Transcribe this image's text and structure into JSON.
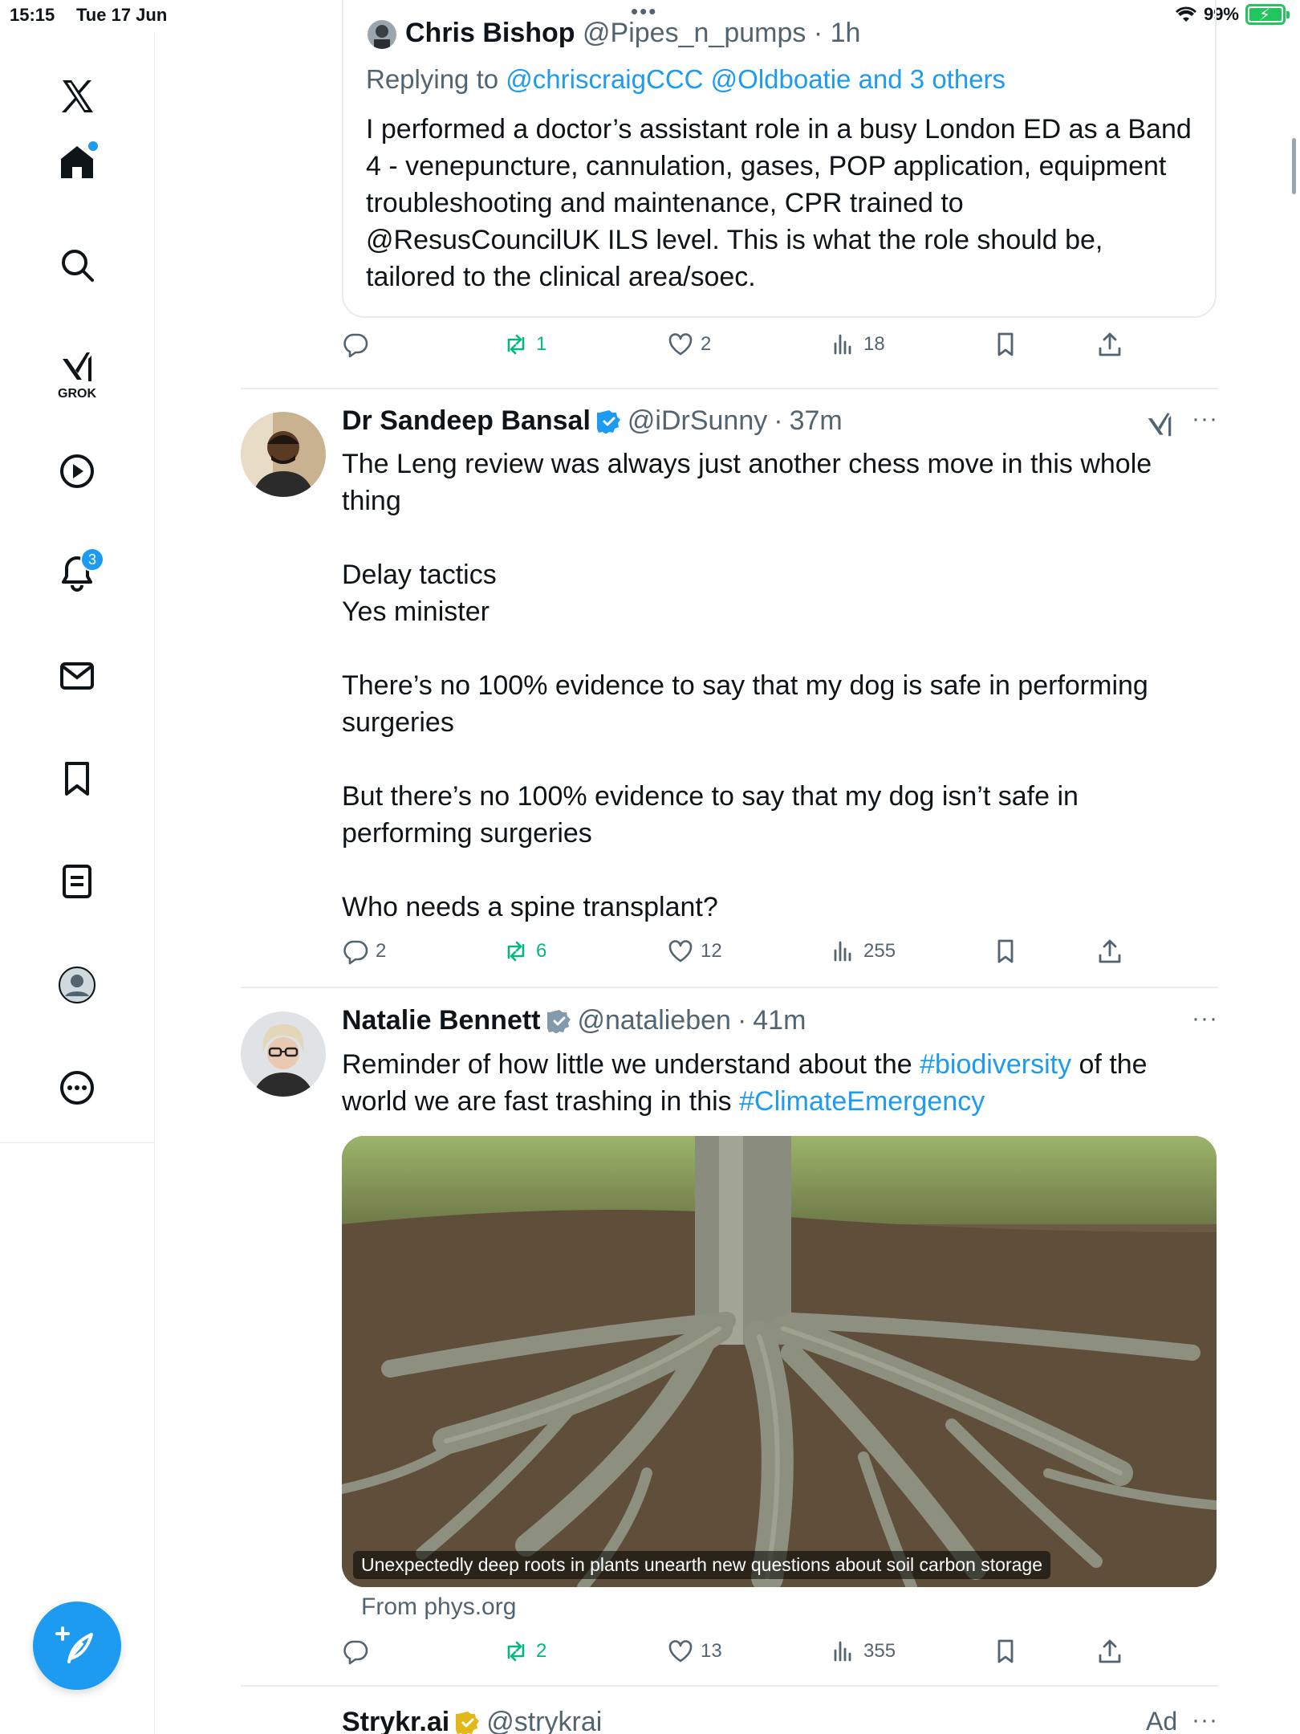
{
  "status_bar": {
    "time": "15:15",
    "date": "Tue 17 Jun",
    "battery": "99%"
  },
  "sidebar": {
    "grok_label": "GROK",
    "notifications_count": "3"
  },
  "quote_post": {
    "author": "Chris Bishop",
    "handle": "@Pipes_n_pumps",
    "time": "1h",
    "replying_prefix": "Replying to",
    "replying_to": "@chriscraigCCC @Oldboatie and 3 others",
    "lines": [
      "I performed a doctor’s assistant role in a busy London ED as a Band",
      "4 - venepuncture, cannulation, gases, POP application, equipment",
      "troubleshooting and maintenance, CPR trained to",
      "@ResusCouncilUK ILS level. This is what the role should be,",
      "tailored to the clinical area/soec."
    ],
    "stats": {
      "replies": "",
      "reposts": "1",
      "likes": "2",
      "views": "18"
    }
  },
  "post1": {
    "author": "Dr Sandeep Bansal",
    "handle": "@iDrSunny",
    "time": "37m",
    "lines": [
      "The Leng review was always just another chess move in this whole",
      "thing",
      "",
      "Delay tactics",
      "Yes minister",
      "",
      "There’s no 100% evidence to say that my dog is safe in performing",
      "surgeries",
      "",
      "But there’s no 100% evidence to say that my dog isn’t safe in",
      "performing surgeries",
      "",
      "Who needs a spine transplant?"
    ],
    "stats": {
      "replies": "2",
      "reposts": "6",
      "likes": "12",
      "views": "255"
    }
  },
  "post2": {
    "author": "Natalie Bennett",
    "handle": "@natalieben",
    "time": "41m",
    "line1_a": "Reminder of how little we understand about the ",
    "hashtag1": "#biodiversity",
    "line1_b": " of the",
    "line2_a": "world we are fast trashing in this ",
    "hashtag2": "#ClimateEmergency",
    "media_caption": "Unexpectedly deep roots in plants unearth new questions about soil carbon storage",
    "from": "From phys.org",
    "stats": {
      "replies": "",
      "reposts": "2",
      "likes": "13",
      "views": "355"
    }
  },
  "post3": {
    "author": "Strykr.ai",
    "handle": "@strykrai",
    "ad_label": "Ad"
  },
  "colors": {
    "accent": "#1d9bf0",
    "repost": "#00ba7c",
    "muted": "#536471",
    "divider": "#e6ecf0"
  }
}
